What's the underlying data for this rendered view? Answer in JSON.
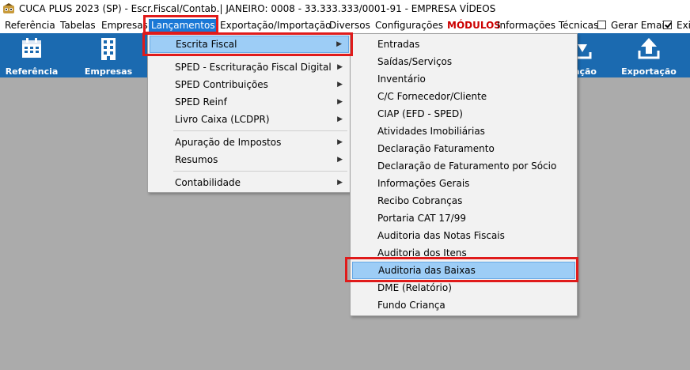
{
  "window": {
    "title": "CUCA PLUS 2023 (SP) - Escr.Fiscal/Contab.| JANEIRO: 0008 - 33.333.333/0001-91 - EMPRESA VÍDEOS"
  },
  "menubar": {
    "items": [
      "Referência",
      "Tabelas",
      "Empresas",
      "Lançamentos",
      "Exportação/Importação",
      "Diversos",
      "Configurações",
      "MÓDULOS",
      "Informações Técnicas"
    ],
    "gerar_email_label": "Gerar Email",
    "exi_label": "Exi"
  },
  "toolbar": {
    "referencia_label": "Referência",
    "empresas_label": "Empresas",
    "partial_label": "ação",
    "exportacao_label": "Exportação"
  },
  "menu_lancamentos": {
    "items": [
      {
        "label": "Escrita Fiscal",
        "submenu": true,
        "highlighted": true
      },
      {
        "label": "SPED - Escrituração Fiscal Digital",
        "submenu": true
      },
      {
        "label": "SPED Contribuições",
        "submenu": true
      },
      {
        "label": "SPED Reinf",
        "submenu": true
      },
      {
        "label": "Livro Caixa (LCDPR)",
        "submenu": true
      },
      {
        "label": "Apuração de Impostos",
        "submenu": true
      },
      {
        "label": "Resumos",
        "submenu": true
      },
      {
        "label": "Contabilidade",
        "submenu": true
      }
    ],
    "arrow": "▶"
  },
  "menu_escrita_fiscal": {
    "items": [
      "Entradas",
      "Saídas/Serviços",
      "Inventário",
      "C/C Fornecedor/Cliente",
      "CIAP (EFD - SPED)",
      "Atividades Imobiliárias",
      "Declaração Faturamento",
      "Declaração de Faturamento por Sócio",
      "Informações Gerais",
      "Recibo Cobranças",
      "Portaria CAT 17/99",
      "Auditoria das Notas Fiscais",
      "Auditoria dos Itens",
      "Auditoria das Baixas",
      "DME (Relatório)",
      "Fundo Criança"
    ],
    "highlighted_index": 13
  },
  "colors": {
    "toolbar": "#1b6ab0",
    "highlight": "#9dcdf6",
    "annotation": "#e01b1b",
    "modules": "#cc0000"
  }
}
